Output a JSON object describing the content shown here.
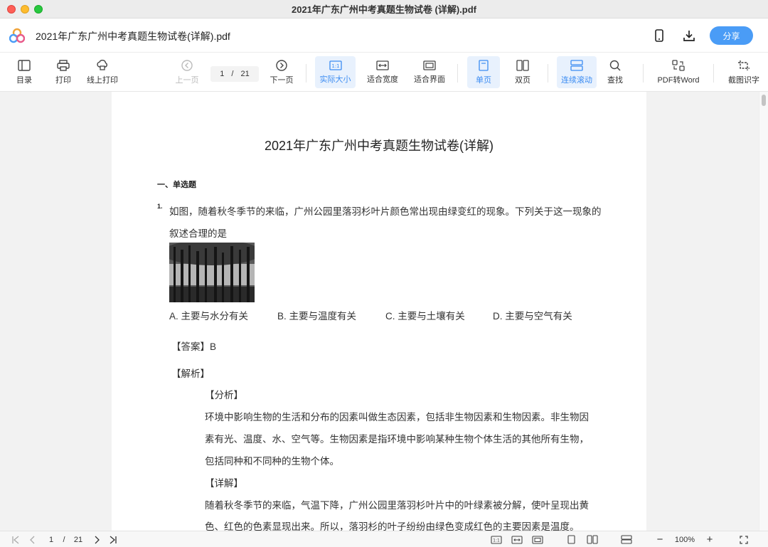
{
  "window": {
    "title": "2021年广东广州中考真题生物试卷 (详解).pdf"
  },
  "header": {
    "doc_title": "2021年广东广州中考真题生物试卷(详解).pdf",
    "share_label": "分享"
  },
  "toolbar": {
    "toc": "目录",
    "print": "打印",
    "online_print": "线上打印",
    "prev_page": "上一页",
    "current_page": "1",
    "page_sep": "/",
    "total_pages": "21",
    "next_page": "下一页",
    "actual_size": "实际大小",
    "actual_size_glyph": "1:1",
    "fit_width": "适合宽度",
    "fit_page": "适合界面",
    "single_page": "单页",
    "double_page": "双页",
    "continuous": "连续滚动",
    "find": "查找",
    "pdf_to_word": "PDF转Word",
    "ocr": "截图识字"
  },
  "document": {
    "title": "2021年广东广州中考真题生物试卷(详解)",
    "section": "一、单选题",
    "q_num": "1.",
    "q_line1": "如图，随着秋冬季节的来临，广州公园里落羽杉叶片颜色常出现由绿变红的现象。下列关于这一现象的",
    "q_line2": "叙述合理的是",
    "options": [
      "A. 主要与水分有关",
      "B. 主要与温度有关",
      "C. 主要与土壤有关",
      "D. 主要与空气有关"
    ],
    "answer_label": "【答案】",
    "answer_value": "B",
    "analysis_label": "【解析】",
    "fenxi_label": "【分析】",
    "fenxi_lines": [
      "环境中影响生物的生活和分布的因素叫做生态因素，包括非生物因素和生物因素。非生物因",
      "素有光、温度、水、空气等。生物因素是指环境中影响某种生物个体生活的其他所有生物，",
      "包括同种和不同种的生物个体。"
    ],
    "xiangjie_label": "【详解】",
    "xiangjie_lines": [
      "随着秋冬季节的来临，气温下降，广州公园里落羽杉叶片中的叶绿素被分解，使叶呈现出黄",
      "色、红色的色素显现出来。所以，落羽杉的叶子纷纷由绿色变成红色的主要因素是温度。"
    ]
  },
  "statusbar": {
    "current_page": "1",
    "page_sep": "/",
    "total_pages": "21",
    "actual_size_glyph": "1:1",
    "zoom_out": "−",
    "zoom": "100%",
    "zoom_in": "+"
  },
  "colors": {
    "accent": "#4a9cf6",
    "active_bg": "#e8f1fd",
    "active_text": "#3b8cf2"
  }
}
